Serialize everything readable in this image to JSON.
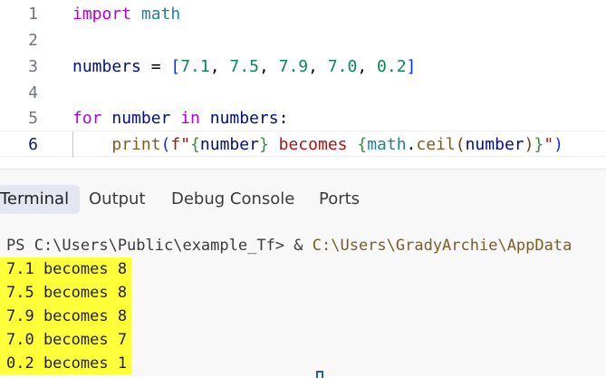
{
  "editor": {
    "lines": [
      {
        "num": "1"
      },
      {
        "num": "2"
      },
      {
        "num": "3"
      },
      {
        "num": "4"
      },
      {
        "num": "5"
      },
      {
        "num": "6"
      }
    ],
    "tokens": {
      "import_kw": "import",
      "import_mod": " math",
      "numbers_var": "numbers",
      "assign": " = ",
      "lbracket": "[",
      "n1": "7.1",
      "n2": "7.5",
      "n3": "7.9",
      "n4": "7.0",
      "n5": "0.2",
      "comma": ", ",
      "rbracket": "]",
      "for_kw": "for",
      "loop_var": " number ",
      "in_kw": "in",
      "iter_var": " numbers",
      "colon": ":",
      "indent": "    ",
      "print_fn": "print",
      "lparen": "(",
      "fstring_start": "f\"",
      "lbrace1": "{",
      "number_ref": "number",
      "rbrace1": "}",
      "becomes_text": " becomes ",
      "lbrace2": "{",
      "math_mod": "math",
      "dot": ".",
      "ceil_fn": "ceil",
      "lparen2": "(",
      "number_ref2": "number",
      "rparen2": ")",
      "rbrace2": "}",
      "fstring_end": "\"",
      "rparen": ")"
    }
  },
  "panel": {
    "tabs": [
      {
        "label": "Terminal"
      },
      {
        "label": "Output"
      },
      {
        "label": "Debug Console"
      },
      {
        "label": "Ports"
      }
    ],
    "terminal": {
      "prompt": "PS C:\\Users\\Public\\example_Tf> & ",
      "command_path": "C:\\Users\\GradyArchie\\AppData",
      "outputs": [
        "7.1 becomes 8",
        "7.5 becomes 8",
        "7.9 becomes 8",
        "7.0 becomes 7",
        "0.2 becomes 1"
      ]
    }
  },
  "colors": {
    "output_highlight": "#ffff3a",
    "active_tab_bg": "#e4e6f1",
    "keyword": "#af00db",
    "number": "#098658",
    "string": "#a31515"
  }
}
